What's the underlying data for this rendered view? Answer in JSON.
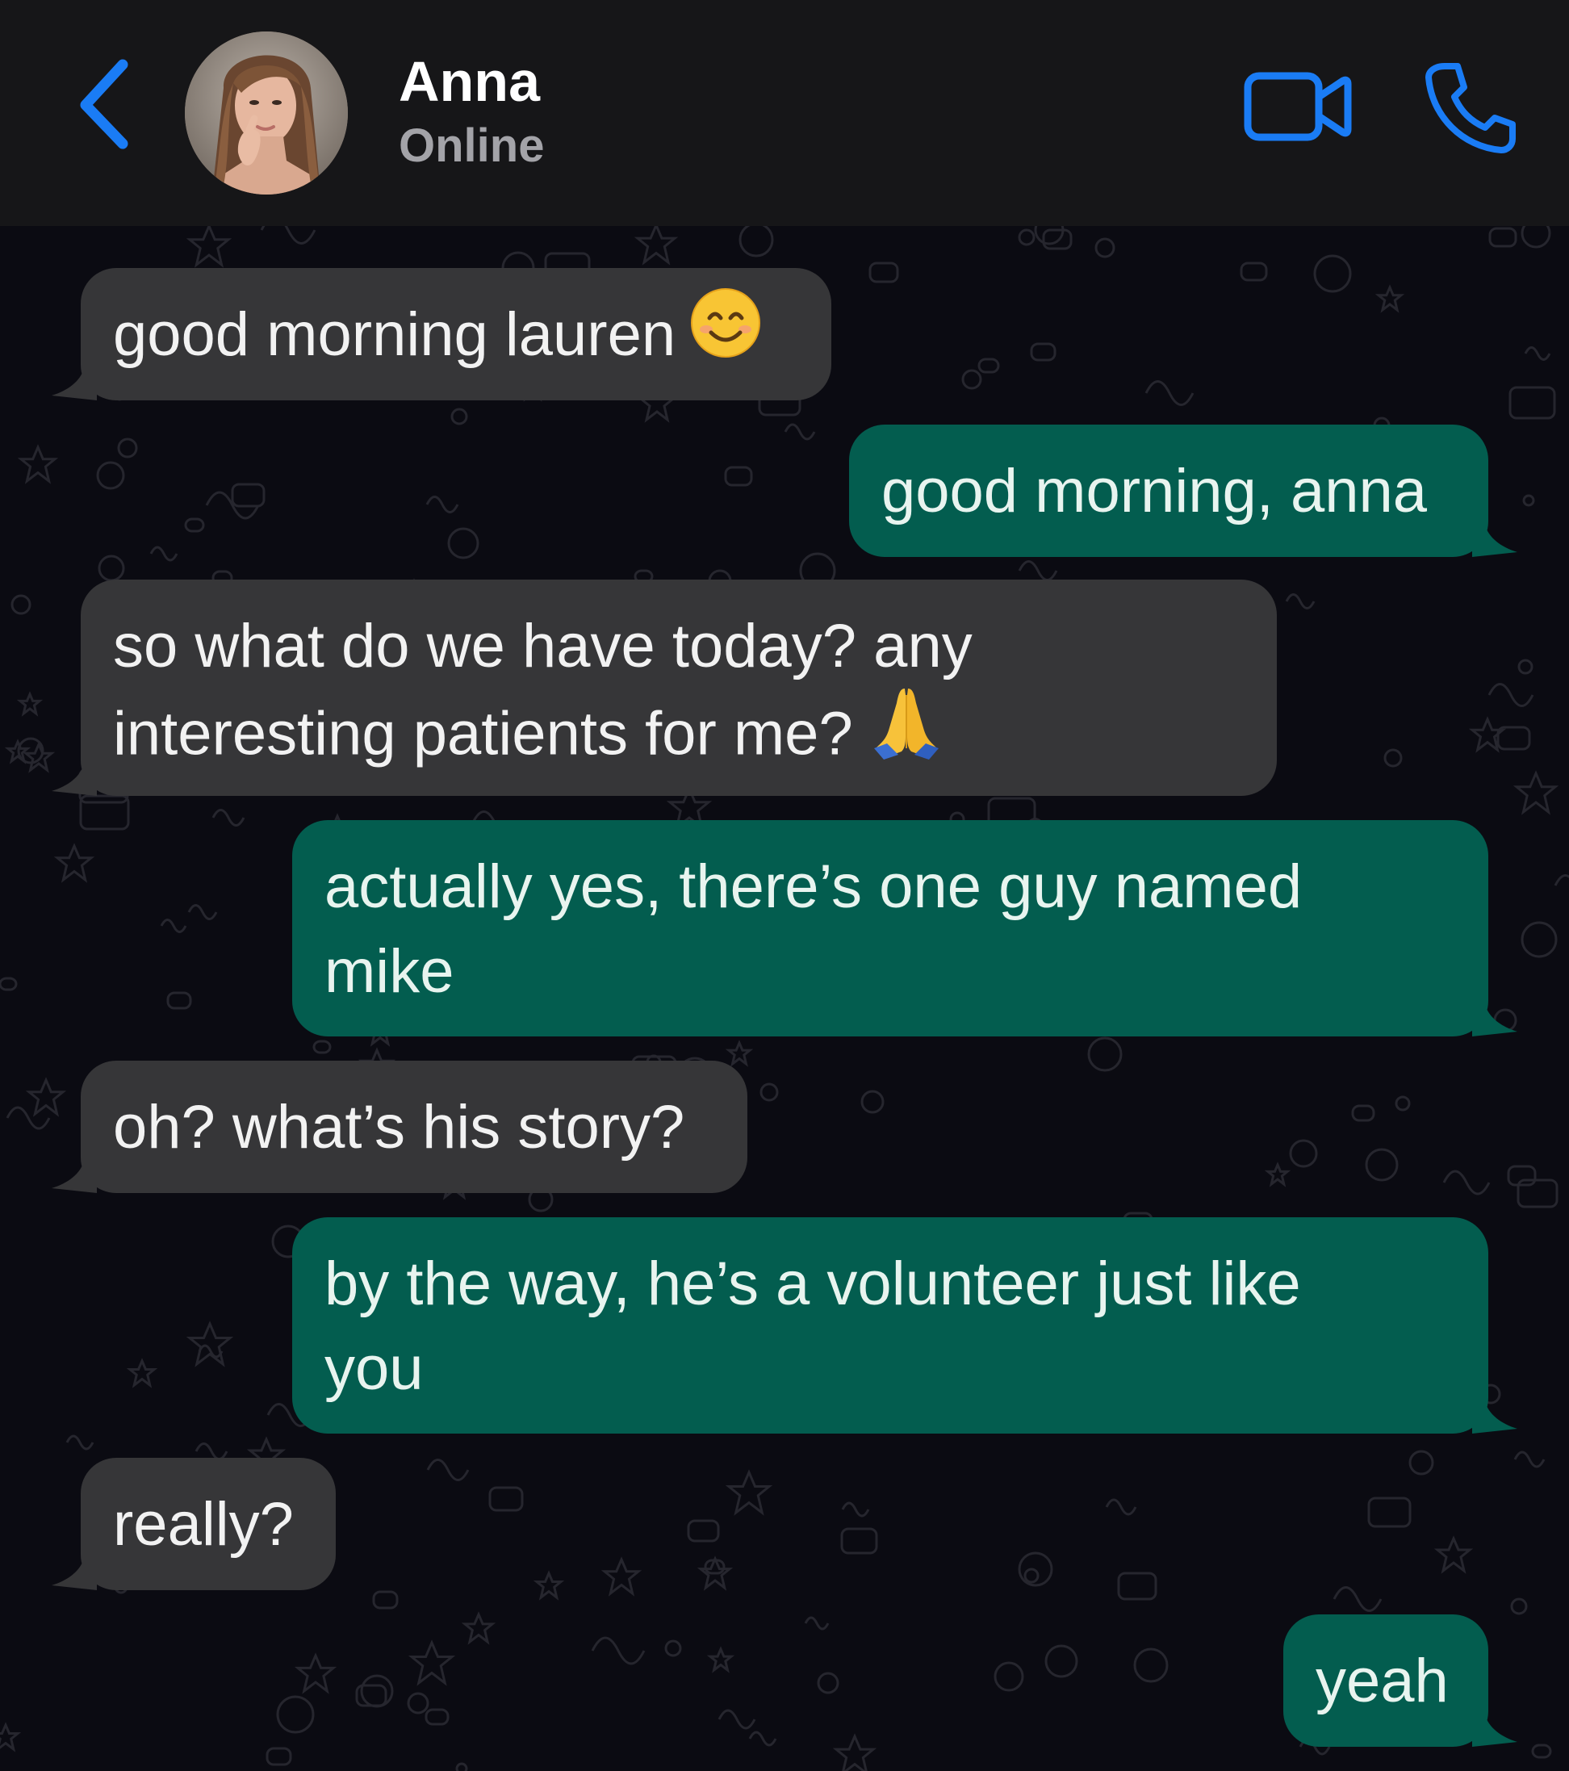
{
  "header": {
    "back_icon": "chevron-left-icon",
    "contact_name": "Anna",
    "contact_status": "Online",
    "video_icon": "video-camera-icon",
    "call_icon": "phone-icon",
    "accent_color": "#1a7cf5"
  },
  "colors": {
    "incoming_bubble": "#363638",
    "outgoing_bubble": "#035d4f",
    "background": "#0b0b12",
    "header_bg": "#161618"
  },
  "messages": [
    {
      "direction": "incoming",
      "text": "good morning lauren",
      "emoji": "smiling-face-emoji"
    },
    {
      "direction": "outgoing",
      "text": "good morning, anna"
    },
    {
      "direction": "incoming",
      "text": "so what do we have today? any interesting patients for me?",
      "emoji": "folded-hands-emoji"
    },
    {
      "direction": "outgoing",
      "text": "actually yes, there’s one guy named mike"
    },
    {
      "direction": "incoming",
      "text": "oh? what’s his story?"
    },
    {
      "direction": "outgoing",
      "text": "by the way, he’s a volunteer just like you"
    },
    {
      "direction": "incoming",
      "text": "really?"
    },
    {
      "direction": "outgoing",
      "text": "yeah"
    }
  ]
}
